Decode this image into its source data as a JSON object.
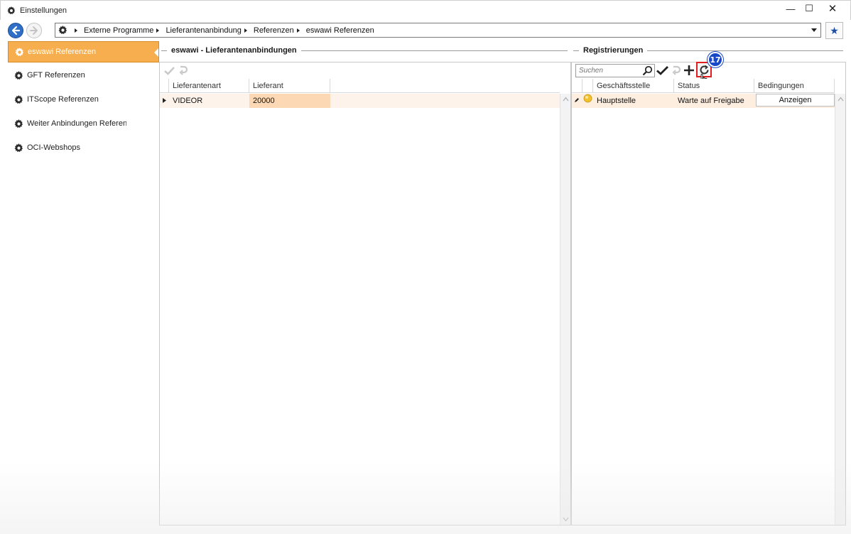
{
  "window": {
    "title": "Einstellungen",
    "controls": {
      "minimize": "—",
      "maximize": "☐",
      "close": "✕"
    }
  },
  "breadcrumb": [
    "Externe Programme",
    "Lieferantenanbindung",
    "Referenzen",
    "eswawi Referenzen"
  ],
  "sidebar": {
    "items": [
      {
        "label": "eswawi Referenzen",
        "active": true
      },
      {
        "label": "GFT Referenzen",
        "active": false
      },
      {
        "label": "ITScope Referenzen",
        "active": false
      },
      {
        "label": "Weiter Anbindungen Referenzen",
        "active": false
      },
      {
        "label": "OCI-Webshops",
        "active": false
      }
    ]
  },
  "left_panel": {
    "title": "eswawi - Lieferantenanbindungen",
    "columns": [
      "Lieferantenart",
      "Lieferant"
    ],
    "rows": [
      {
        "lieferantenart": "VIDEOR",
        "lieferant": "20000"
      }
    ]
  },
  "right_panel": {
    "title": "Registrierungen",
    "search": {
      "placeholder": "Suchen",
      "value": ""
    },
    "step_badge": "17",
    "columns": [
      "Geschäftsstelle",
      "Status",
      "Bedingungen"
    ],
    "rows": [
      {
        "geschaeftsstelle": "Hauptstelle",
        "status": "Warte auf Freigabe",
        "bedingungen": "Anzeigen"
      }
    ]
  },
  "colors": {
    "accent_orange": "#f6ae4e",
    "selected_row": "#fdeee0",
    "nav_blue": "#2f6fc7",
    "badge_blue": "#1947c9",
    "highlight_red": "#e02020"
  },
  "icons": [
    "gear-icon",
    "back-arrow-icon",
    "forward-arrow-icon",
    "star-icon",
    "checkmark-icon",
    "undo-icon",
    "plus-icon",
    "refresh-icon",
    "search-icon",
    "row-indicator-icon",
    "edit-pen-icon",
    "status-dot-icon"
  ]
}
